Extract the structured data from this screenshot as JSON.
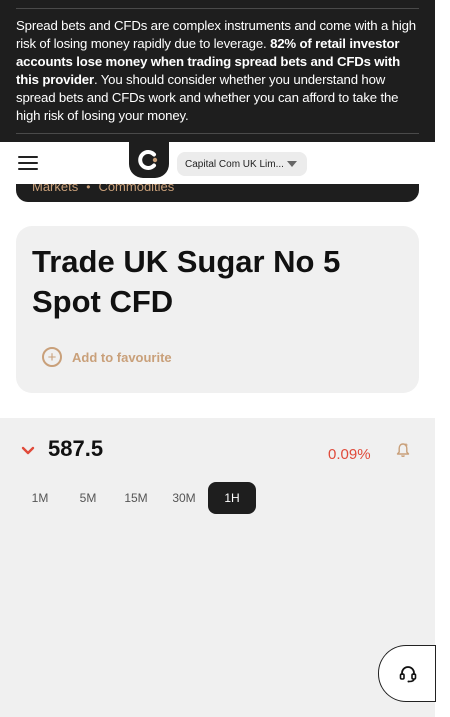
{
  "risk_warning": {
    "intro": "Spread bets and CFDs are complex instruments and come with a high risk of losing money rapidly due to leverage. ",
    "emphasis": "82% of retail investor accounts lose money when trading spread bets and CFDs with this provider",
    "outro": ". You should consider whether you understand how spread bets and CFDs work and whether you can afford to take the high risk of losing your money."
  },
  "header": {
    "logo_icon": "capital-com-logo",
    "entity_selector": "Capital Com UK Lim..."
  },
  "breadcrumb": {
    "items": [
      "Markets",
      "Commodities"
    ],
    "separator": "•"
  },
  "instrument": {
    "title": "Trade UK Sugar No 5 Spot CFD",
    "favourite_label": "Add to favourite"
  },
  "quote": {
    "price": "587.5",
    "change": "0.09%",
    "direction": "down"
  },
  "timeframes": {
    "items": [
      "1M",
      "5M",
      "15M",
      "30M",
      "1H"
    ],
    "active": "1H"
  },
  "colors": {
    "accent": "#c9a07a",
    "negative": "#e04a3a",
    "dark": "#1e1e1e"
  }
}
